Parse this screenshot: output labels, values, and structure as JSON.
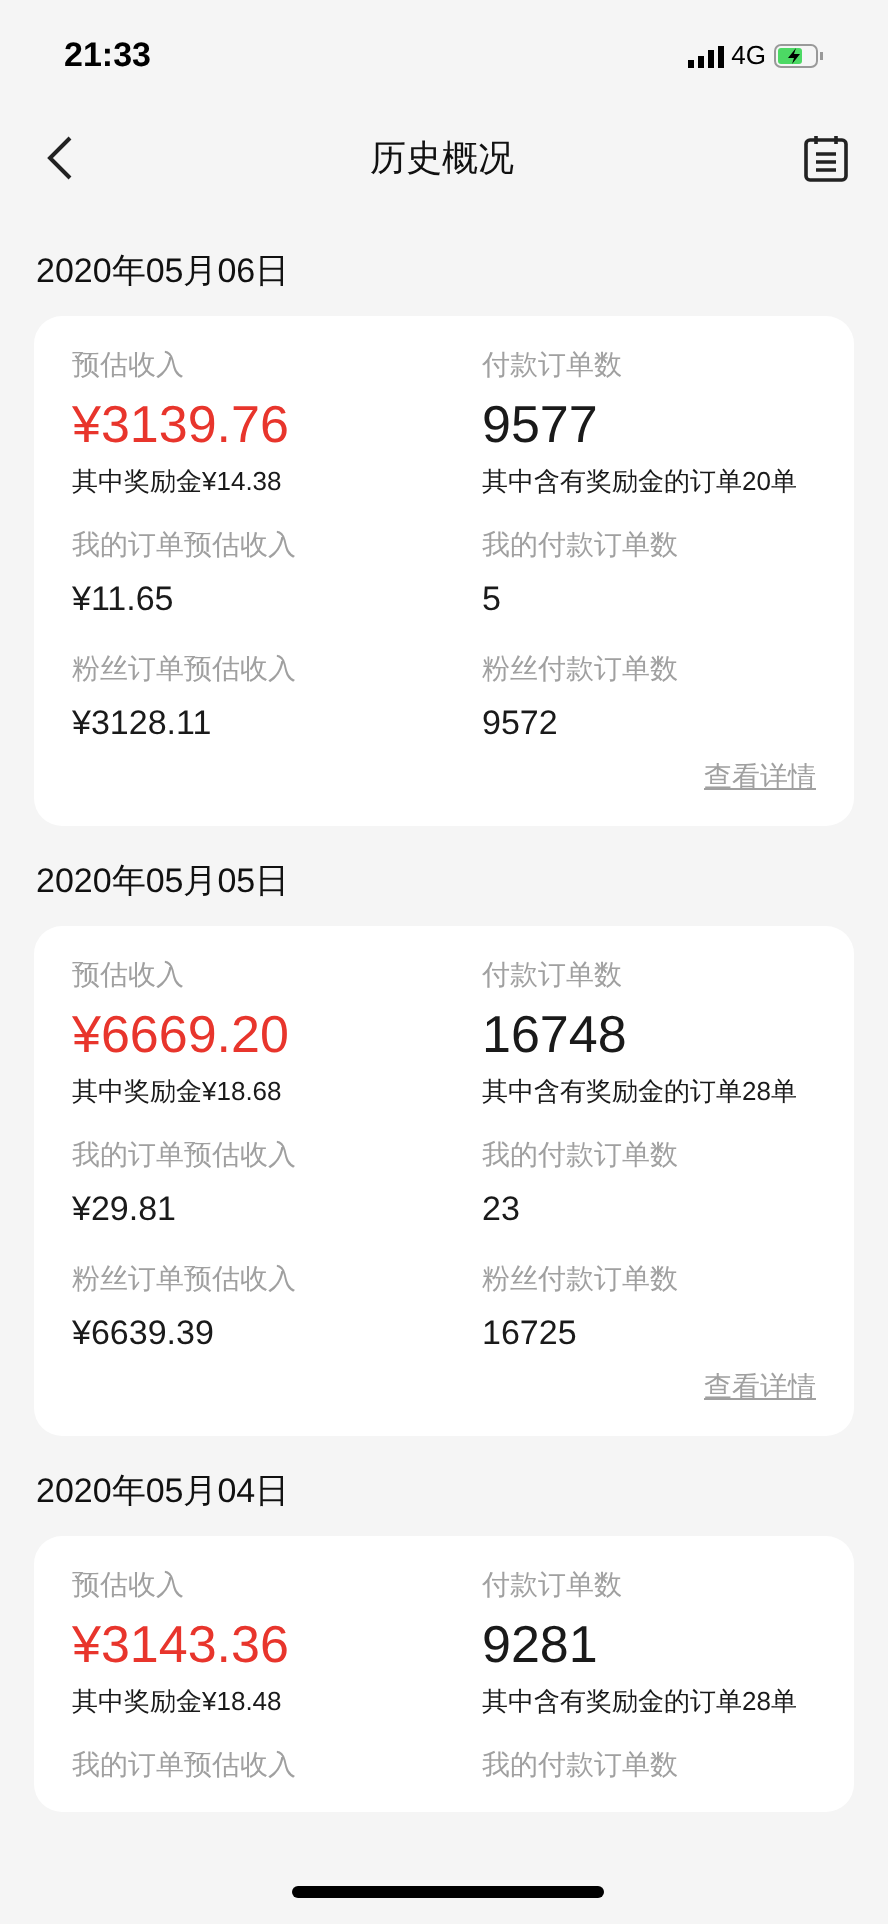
{
  "status_bar": {
    "time": "21:33",
    "network": "4G"
  },
  "nav": {
    "title": "历史概况"
  },
  "days": [
    {
      "date": "2020年05月06日",
      "income": {
        "label": "预估收入",
        "value": "¥3139.76",
        "note": "其中奖励金¥14.38"
      },
      "orders": {
        "label": "付款订单数",
        "value": "9577",
        "note": "其中含有奖励金的订单20单"
      },
      "rows": [
        {
          "left": {
            "label": "我的订单预估收入",
            "value": "¥11.65"
          },
          "right": {
            "label": "我的付款订单数",
            "value": "5"
          }
        },
        {
          "left": {
            "label": "粉丝订单预估收入",
            "value": "¥3128.11"
          },
          "right": {
            "label": "粉丝付款订单数",
            "value": "9572"
          }
        }
      ],
      "link": "查看详情"
    },
    {
      "date": "2020年05月05日",
      "income": {
        "label": "预估收入",
        "value": "¥6669.20",
        "note": "其中奖励金¥18.68"
      },
      "orders": {
        "label": "付款订单数",
        "value": "16748",
        "note": "其中含有奖励金的订单28单"
      },
      "rows": [
        {
          "left": {
            "label": "我的订单预估收入",
            "value": "¥29.81"
          },
          "right": {
            "label": "我的付款订单数",
            "value": "23"
          }
        },
        {
          "left": {
            "label": "粉丝订单预估收入",
            "value": "¥6639.39"
          },
          "right": {
            "label": "粉丝付款订单数",
            "value": "16725"
          }
        }
      ],
      "link": "查看详情"
    },
    {
      "date": "2020年05月04日",
      "income": {
        "label": "预估收入",
        "value": "¥3143.36",
        "note": "其中奖励金¥18.48"
      },
      "orders": {
        "label": "付款订单数",
        "value": "9281",
        "note": "其中含有奖励金的订单28单"
      },
      "rows": [
        {
          "left": {
            "label": "我的订单预估收入"
          },
          "right": {
            "label": "我的付款订单数"
          }
        }
      ]
    }
  ]
}
